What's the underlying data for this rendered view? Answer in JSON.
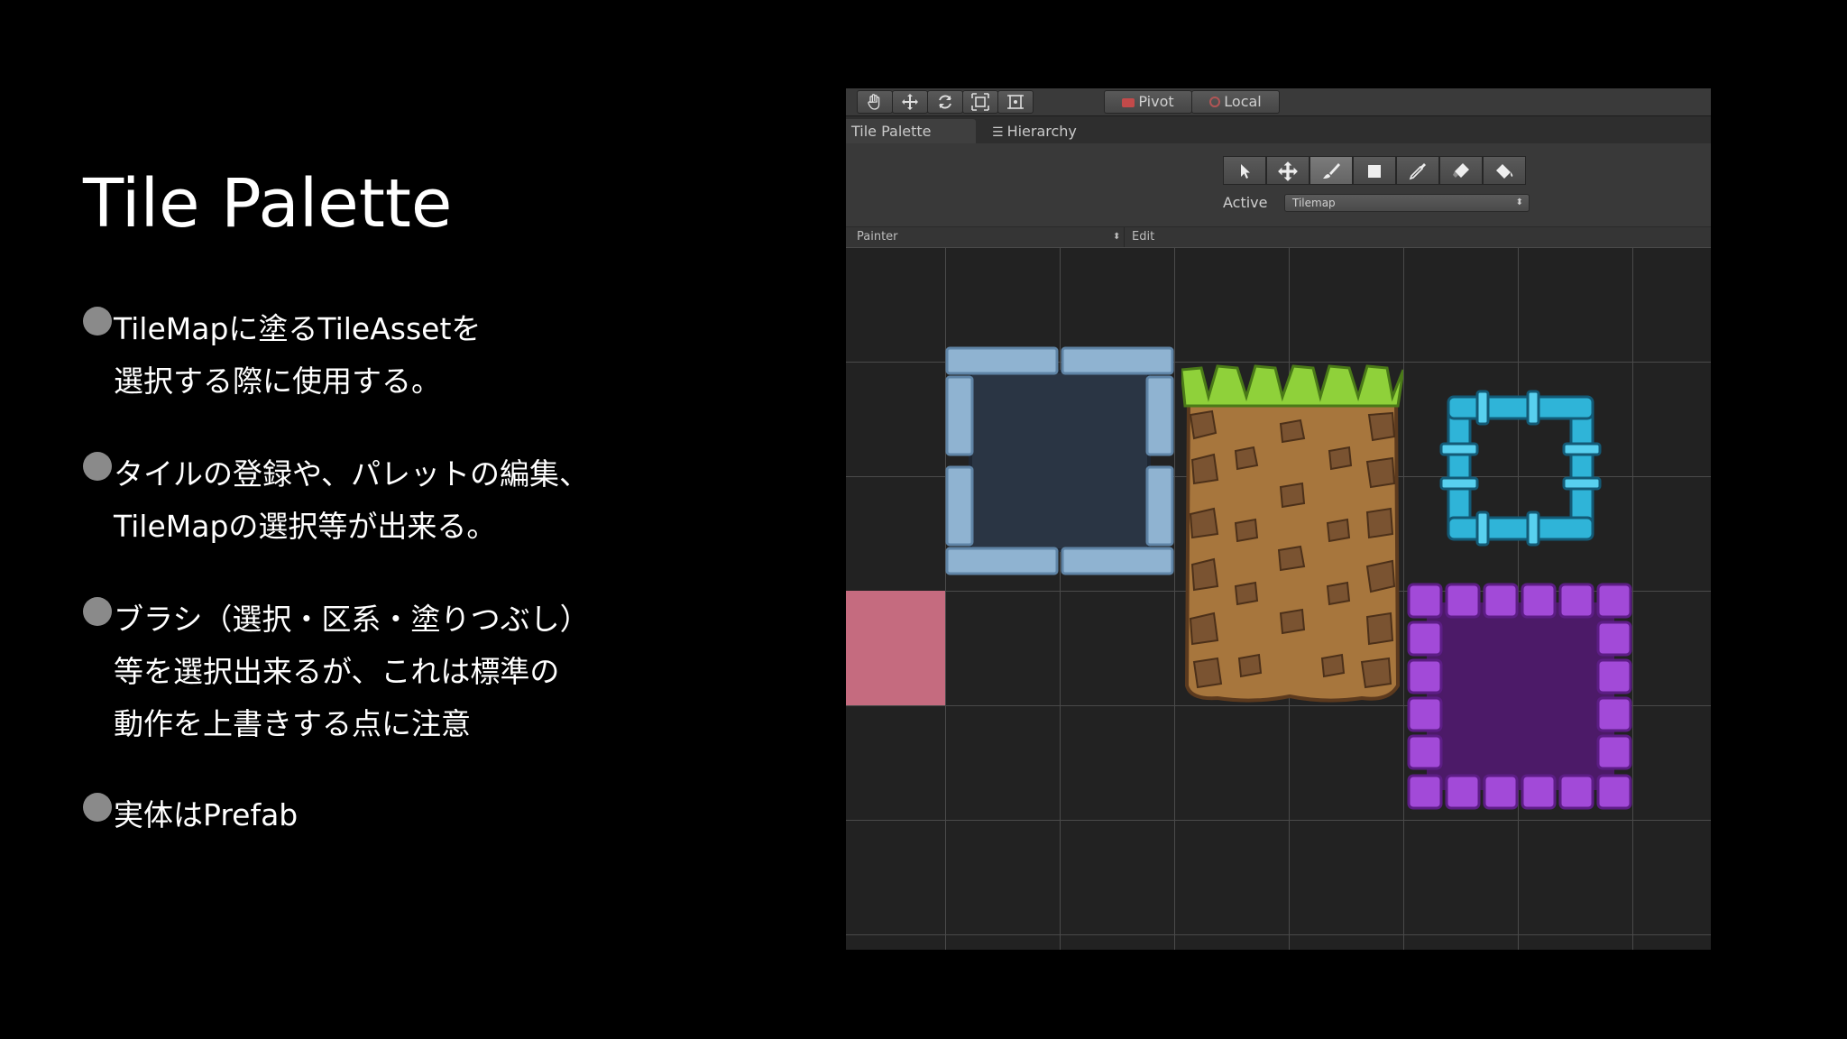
{
  "slide": {
    "title": "Tile Palette",
    "bullets": [
      {
        "lines": "TileMapに塗るTileAssetを\n選択する際に使用する。"
      },
      {
        "lines": "タイルの登録や、パレットの編集、\nTileMapの選択等が出来る。"
      },
      {
        "lines": "ブラシ（選択・区系・塗りつぶし）\n等を選択出来るが、これは標準の\n動作を上書きする点に注意"
      },
      {
        "lines": "実体はPrefab"
      }
    ]
  },
  "unity": {
    "toolbar": {
      "pivot_label": "Pivot",
      "local_label": "Local"
    },
    "tabs": {
      "tile_palette": "Tile Palette",
      "hierarchy": "Hierarchy"
    },
    "active_label": "Active",
    "active_value": "Tilemap",
    "palette_select": "Painter",
    "edit_label": "Edit",
    "swatch_color": "#c56b7f"
  }
}
